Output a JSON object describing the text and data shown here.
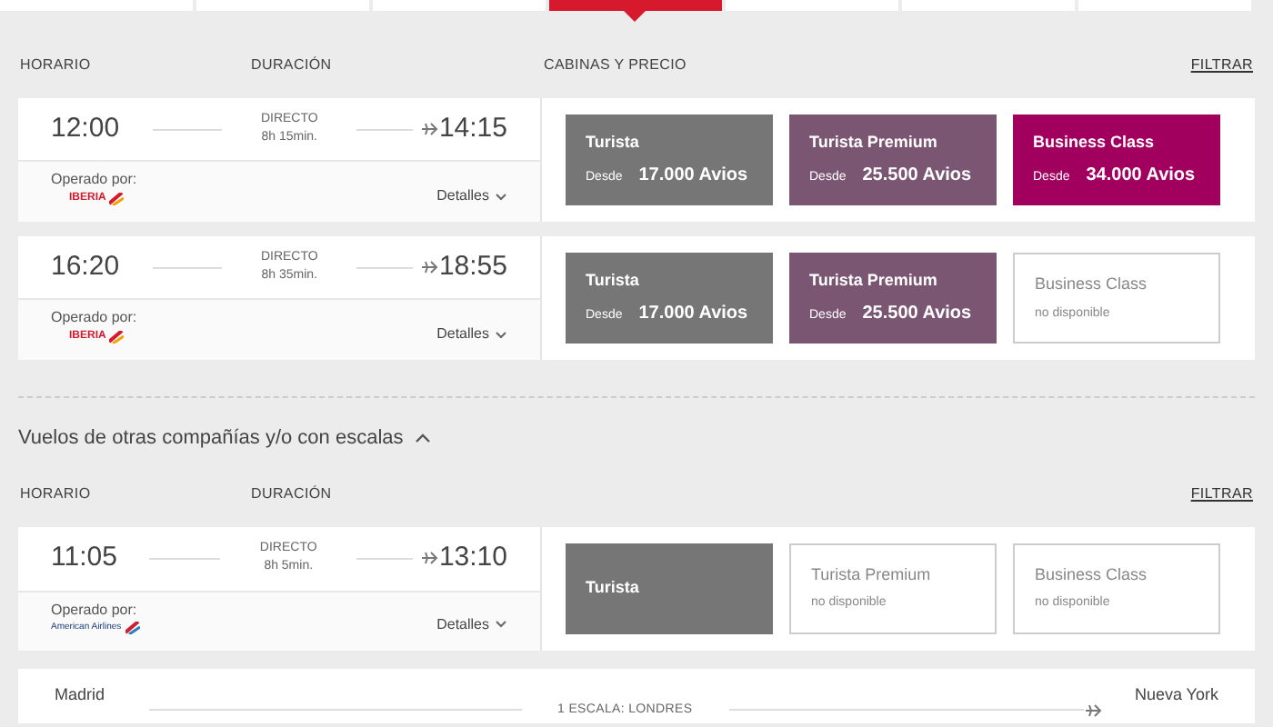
{
  "date_tabs": [
    {
      "selected": false
    },
    {
      "selected": false
    },
    {
      "selected": false
    },
    {
      "selected": true
    },
    {
      "selected": false
    },
    {
      "selected": false
    },
    {
      "selected": false
    }
  ],
  "direct_section": {
    "headers": {
      "schedule": "HORARIO",
      "duration": "DURACIÓN",
      "cabins": "CABINAS Y PRECIO",
      "filter": "FILTRAR"
    },
    "flights": [
      {
        "depart": "12:00",
        "arrive": "14:15",
        "type": "DIRECTO",
        "duration": "8h 15min.",
        "operated_label": "Operado por:",
        "operator": {
          "kind": "iberia",
          "text": "IBERIA"
        },
        "details": "Detalles",
        "fares": [
          {
            "kind": "price",
            "name": "Turista",
            "from": "Desde",
            "price": "17.000 Avios",
            "color": "#767676"
          },
          {
            "kind": "price",
            "name": "Turista Premium",
            "from": "Desde",
            "price": "25.500 Avios",
            "color": "#7a5673"
          },
          {
            "kind": "price",
            "name": "Business Class",
            "from": "Desde",
            "price": "34.000 Avios",
            "color": "#a1005f"
          }
        ]
      },
      {
        "depart": "16:20",
        "arrive": "18:55",
        "type": "DIRECTO",
        "duration": "8h 35min.",
        "operated_label": "Operado por:",
        "operator": {
          "kind": "iberia",
          "text": "IBERIA"
        },
        "details": "Detalles",
        "fares": [
          {
            "kind": "price",
            "name": "Turista",
            "from": "Desde",
            "price": "17.000 Avios",
            "color": "#767676"
          },
          {
            "kind": "price",
            "name": "Turista Premium",
            "from": "Desde",
            "price": "25.500 Avios",
            "color": "#7a5673"
          },
          {
            "kind": "unavailable",
            "name": "Business Class",
            "note": "no disponible"
          }
        ]
      }
    ]
  },
  "other_section": {
    "title": "Vuelos de otras compañías y/o con escalas",
    "expanded": true,
    "headers": {
      "schedule": "HORARIO",
      "duration": "DURACIÓN",
      "filter": "FILTRAR"
    },
    "flights": [
      {
        "depart": "11:05",
        "arrive": "13:10",
        "type": "DIRECTO",
        "duration": "8h 5min.",
        "operated_label": "Operado por:",
        "operator": {
          "kind": "american",
          "text": "American Airlines"
        },
        "details": "Detalles",
        "fares": [
          {
            "kind": "name_only",
            "name": "Turista",
            "color": "#767676"
          },
          {
            "kind": "unavailable",
            "name": "Turista Premium",
            "note": "no disponible"
          },
          {
            "kind": "unavailable",
            "name": "Business Class",
            "note": "no disponible"
          }
        ]
      }
    ],
    "stopover_flight": {
      "origin": "Madrid",
      "destination": "Nueva York",
      "stops": "1 ESCALA: LONDRES"
    }
  }
}
